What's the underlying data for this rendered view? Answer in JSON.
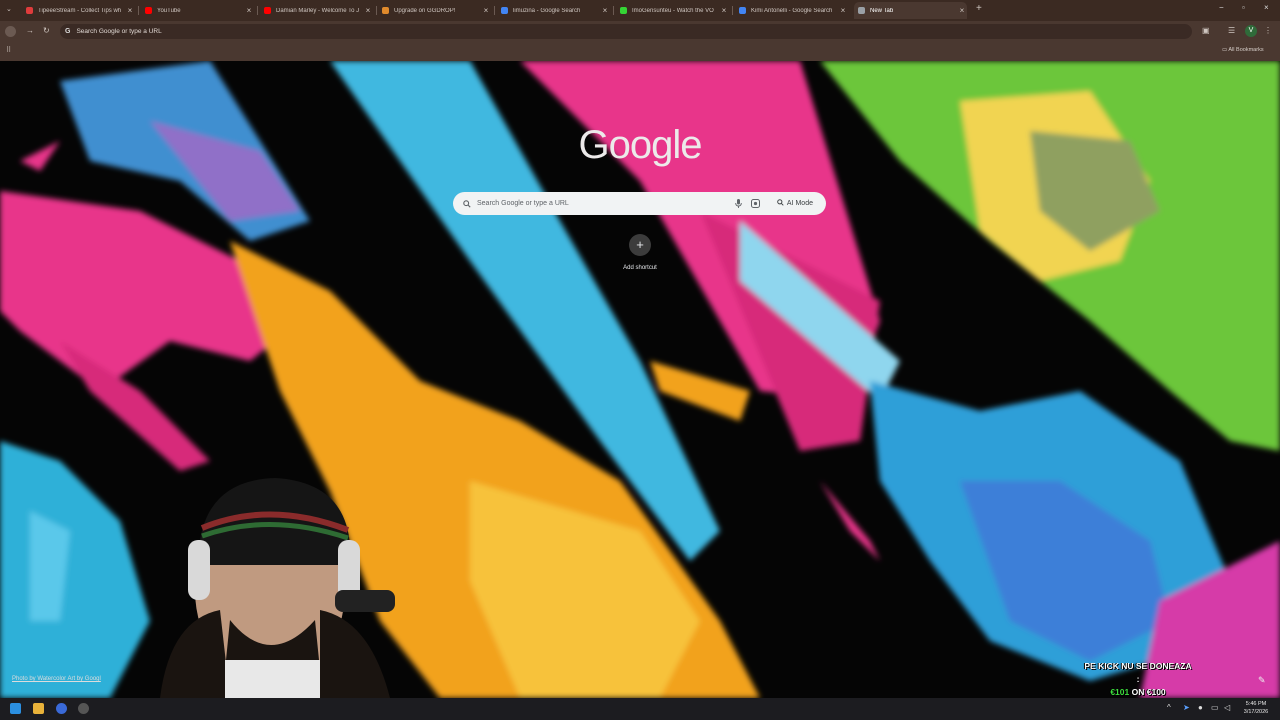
{
  "tabs": [
    {
      "title": "TipeeeStream - Collect Tips wh",
      "color": "#e03c3c"
    },
    {
      "title": "YouTube",
      "color": "#ff0000"
    },
    {
      "title": "Damian Marley - Welcome To J",
      "color": "#ff0000"
    },
    {
      "title": "Upgrade on GGDROP!",
      "color": "#e08a2c"
    },
    {
      "title": "limuzina - Google Search",
      "color": "#4285f4"
    },
    {
      "title": "ImoGensunteu - Watch the VO",
      "color": "#35d435"
    },
    {
      "title": "Kimi Antonelli - Google Search",
      "color": "#4285f4"
    },
    {
      "title": "New Tab",
      "color": "#9aa0a6"
    }
  ],
  "new_tab_symbol": "+",
  "omnibox": {
    "placeholder": "Search Google or type a URL"
  },
  "bookmarks": {
    "all_bookmarks": "All Bookmarks"
  },
  "ntp": {
    "logo": "Google",
    "search_placeholder": "Search Google or type a URL",
    "ai_mode": "AI Mode",
    "add_shortcut": "Add shortcut",
    "add_symbol": "+"
  },
  "background_credit": "Photo by Watercolor Art by Googl",
  "stream_overlay": {
    "line1": "PE KICK NU SE DONEAZA :",
    "amount": "€101",
    "sep": " ON ",
    "goal": "€100"
  },
  "clock": {
    "time": "5:46 PM",
    "date": "3/17/2026"
  },
  "icons": {
    "close": "×",
    "minimize": "−",
    "maximize": "▫",
    "search": "search-icon",
    "mic": "mic-icon",
    "lens": "lens-icon"
  }
}
